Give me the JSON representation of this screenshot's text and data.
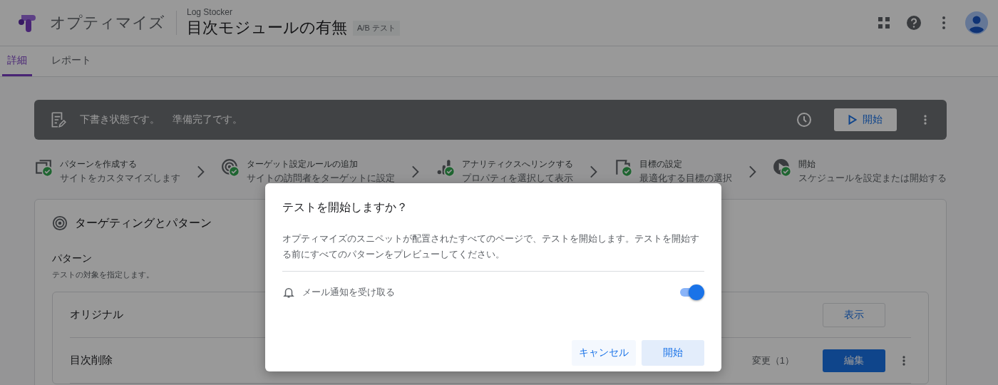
{
  "app": {
    "name": "オプティマイズ"
  },
  "experiment": {
    "account": "Log Stocker",
    "title": "目次モジュールの有無",
    "badge": "A/B テスト"
  },
  "tabs": [
    {
      "label": "詳細",
      "selected": true
    },
    {
      "label": "レポート",
      "selected": false
    }
  ],
  "status_bar": {
    "messages": [
      "下書き状態です。",
      "準備完了です。"
    ],
    "start_button": "開始"
  },
  "steps": [
    {
      "kind": "pages",
      "title": "パターンを作成する",
      "subtitle": "サイトをカスタマイズします",
      "done": true
    },
    {
      "kind": "target",
      "title": "ターゲット設定ルールの追加",
      "subtitle": "サイトの訪問者をターゲットに設定",
      "done": true
    },
    {
      "kind": "analytics",
      "title": "アナリティクスへリンクする",
      "subtitle": "プロパティを選択して表示",
      "done": true
    },
    {
      "kind": "flag",
      "title": "目標の設定",
      "subtitle": "最適化する目標の選択",
      "done": true
    },
    {
      "kind": "play",
      "title": "開始",
      "subtitle": "スケジュールを設定または開始する",
      "done": true
    }
  ],
  "section": {
    "title": "ターゲティングとパターン",
    "variants_heading": "パターン",
    "variants_hint": "テストの対象を指定します。",
    "variants": [
      {
        "kind": "original",
        "name": "オリジナル",
        "button": "表示"
      },
      {
        "kind": "variant",
        "name": "目次削除",
        "changes": "変更（1）",
        "button": "編集"
      }
    ]
  },
  "dialog": {
    "title": "テストを開始しますか？",
    "body": "オプティマイズのスニペットが配置されたすべてのページで、テストを開始します。テストを開始する前にすべてのパターンをプレビューしてください。",
    "email_notification": {
      "label": "メール通知を受け取る",
      "on": true
    },
    "buttons": [
      "キャンセル",
      "開始"
    ]
  }
}
